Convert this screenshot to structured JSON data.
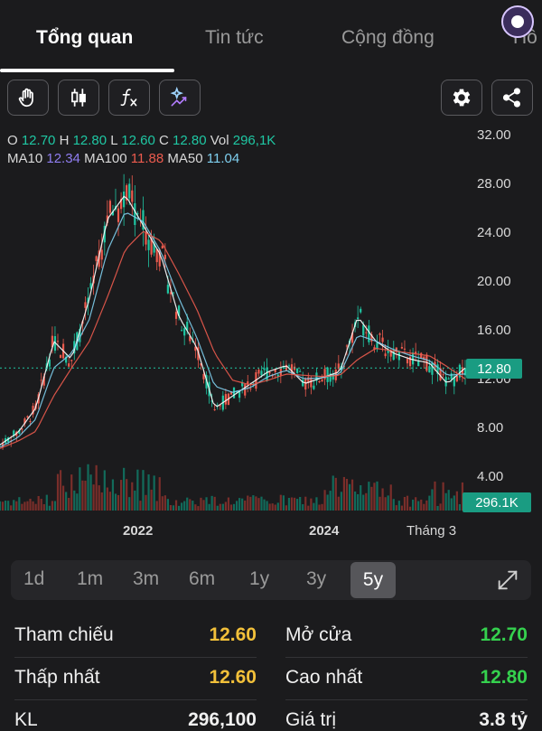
{
  "tabs": [
    {
      "label": "Tổng quan",
      "active": true
    },
    {
      "label": "Tin tức",
      "active": false
    },
    {
      "label": "Cộng đồng",
      "active": false
    },
    {
      "label": "Hồ",
      "active": false
    }
  ],
  "toolbar": {
    "left_icons": [
      "hand-icon",
      "candlestick-icon",
      "function-icon",
      "ai-sparkle-icon"
    ],
    "right_icons": [
      "gear-icon",
      "share-icon"
    ]
  },
  "ohlc": {
    "o_label": "O",
    "o": "12.70",
    "h_label": "H",
    "h": "12.80",
    "l_label": "L",
    "l": "12.60",
    "c_label": "C",
    "c": "12.80",
    "vol_label": "Vol",
    "vol": "296,1K"
  },
  "ma": {
    "ma10_label": "MA10",
    "ma10": "12.34",
    "ma100_label": "MA100",
    "ma100": "11.88",
    "ma50_label": "MA50",
    "ma50": "11.04"
  },
  "chart_data": {
    "type": "line",
    "y_ticks": [
      "32.00",
      "28.00",
      "24.00",
      "20.00",
      "16.00",
      "12.00",
      "8.00",
      "4.00"
    ],
    "ylim": [
      0,
      33
    ],
    "x_ticks": [
      "2022",
      "2024",
      "Tháng 3"
    ],
    "current_price": "12.80",
    "current_volume": "296.1K",
    "series": [
      {
        "values": [
          6.5,
          7.5,
          9.5,
          15,
          13.5,
          18.5,
          25,
          27,
          24.5,
          22,
          17,
          14.5,
          9.5,
          10.5,
          11.5,
          12.5,
          13,
          11.5,
          12,
          12.5,
          17,
          15,
          14,
          13.5,
          13.2,
          11.5,
          12.8
        ]
      },
      {
        "values": [
          6.3,
          7.1,
          8.6,
          12.8,
          14,
          16.8,
          22.4,
          25.6,
          24.8,
          22.3,
          18.5,
          15.3,
          11.3,
          10.8,
          11.2,
          12.1,
          12.6,
          11.9,
          12,
          12.3,
          15.5,
          15,
          14.3,
          13.8,
          13.4,
          12.2,
          12.3
        ]
      },
      {
        "values": [
          6.2,
          6.8,
          7.6,
          10.5,
          12.8,
          15,
          18.6,
          22.5,
          24,
          23.2,
          20.5,
          17.6,
          14,
          11.8,
          11.4,
          11.8,
          12.3,
          12.2,
          12.1,
          12.2,
          13.5,
          14.4,
          14.2,
          14,
          13.8,
          12.9,
          11.9
        ]
      }
    ],
    "colors": {
      "candle_up": "#1fc7a3",
      "candle_down": "#ec5b4e",
      "ma10": "#ffffff",
      "ma50": "#7fd0f0",
      "ma100": "#ec5b4e"
    }
  },
  "periods": [
    "1d",
    "1m",
    "3m",
    "6m",
    "1y",
    "3y",
    "5y"
  ],
  "active_period": "5y",
  "stats": {
    "tham_chieu_label": "Tham chiếu",
    "tham_chieu": "12.60",
    "mo_cua_label": "Mở cửa",
    "mo_cua": "12.70",
    "thap_nhat_label": "Thấp nhất",
    "thap_nhat": "12.60",
    "cao_nhat_label": "Cao nhất",
    "cao_nhat": "12.80",
    "kl_label": "KL",
    "kl": "296,100",
    "gia_tri_label": "Giá trị",
    "gia_tri": "3.8 tỷ"
  }
}
